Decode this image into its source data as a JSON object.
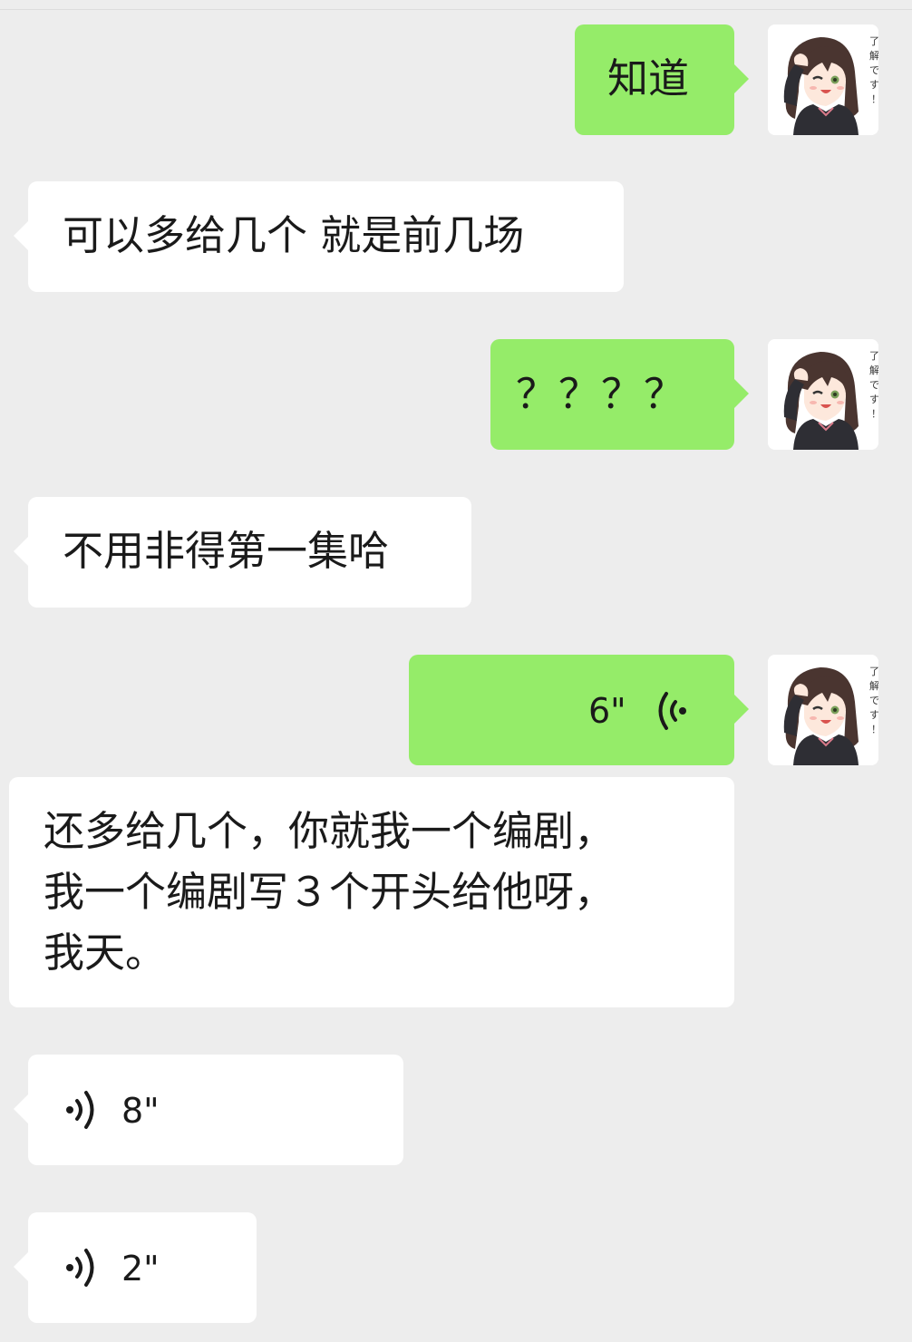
{
  "messages": [
    {
      "side": "sent",
      "type": "text",
      "text": "知道"
    },
    {
      "side": "received",
      "type": "text",
      "text": "可以多给几个 就是前几场"
    },
    {
      "side": "sent",
      "type": "text",
      "text": "？？？？"
    },
    {
      "side": "received",
      "type": "text",
      "text": "不用非得第一集哈"
    },
    {
      "side": "sent",
      "type": "voice",
      "duration": "6\""
    },
    {
      "side": "received",
      "type": "text",
      "lines": [
        "还多给几个，你就我一个编剧，",
        "我一个编剧写３个开头给他呀，",
        "我天。"
      ]
    },
    {
      "side": "received",
      "type": "voice",
      "duration": "8\""
    },
    {
      "side": "received",
      "type": "voice",
      "duration": "2\""
    }
  ],
  "avatar": {
    "icon": "anime-girl-avatar-icon",
    "caption": "了解です！"
  },
  "colors": {
    "background": "#ededed",
    "sent_bubble": "#95ec69",
    "received_bubble": "#ffffff"
  }
}
